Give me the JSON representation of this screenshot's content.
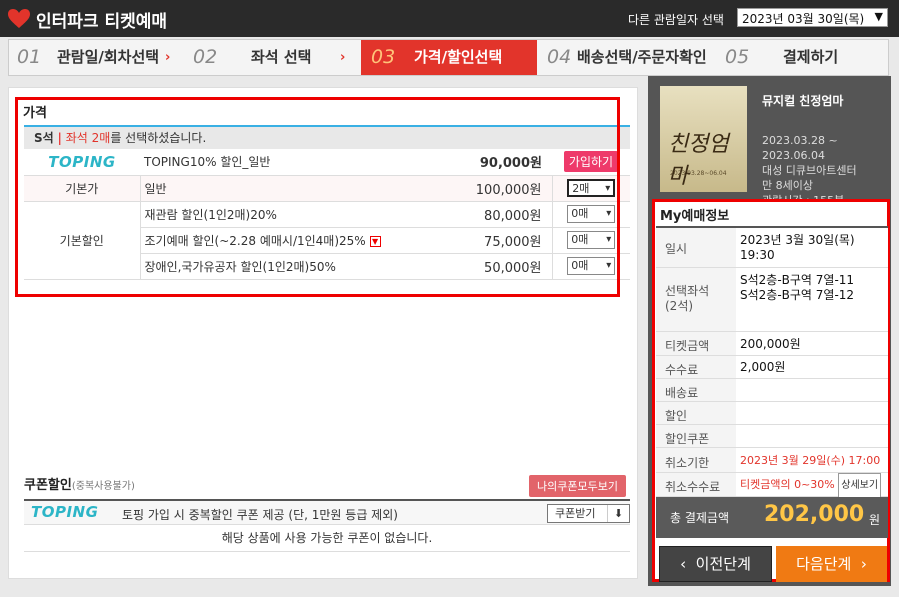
{
  "header": {
    "brand": "인터파크 티켓예매",
    "other_date_label": "다른 관람일자 선택",
    "selected_date": "2023년 03월 30일(목)"
  },
  "steps": [
    {
      "num": "01",
      "label": "관람일/회차선택"
    },
    {
      "num": "02",
      "label": "좌석 선택"
    },
    {
      "num": "03",
      "label": "가격/할인선택"
    },
    {
      "num": "04",
      "label": "배송선택/주문자확인"
    },
    {
      "num": "05",
      "label": "결제하기"
    }
  ],
  "price": {
    "title": "가격",
    "seat_grade": "S석",
    "seat_msg_hl": "좌석 2매",
    "seat_msg_rest": "를 선택하셨습니다.",
    "toping_logo": "TOPING",
    "toping_name": "TOPING10% 할인_일반",
    "toping_price": "90,000원",
    "join_label": "가입하기",
    "basic_label": "기본가",
    "basic_name": "일반",
    "basic_price": "100,000원",
    "basic_qty": "2매",
    "discount_label": "기본할인",
    "discounts": [
      {
        "name": "재관람 할인(1인2매)20%",
        "price": "80,000원",
        "qty": "0매"
      },
      {
        "name": "조기예매 할인(~2.28 예매시/1인4매)25%",
        "price": "75,000원",
        "qty": "0매"
      },
      {
        "name": "장애인,국가유공자 할인(1인2매)50%",
        "price": "50,000원",
        "qty": "0매"
      }
    ]
  },
  "coupon": {
    "title": "쿠폰할인",
    "note": "(중복사용불가)",
    "my_coupon_button": "나의쿠폰모두보기",
    "toping_logo": "TOPING",
    "row_text": "토핑 가입 시 중복할인 쿠폰 제공 (단, 1만원 등급 제외)",
    "receive_button": "쿠폰받기",
    "empty_text": "해당 상품에 사용 가능한 쿠폰이 없습니다."
  },
  "show": {
    "poster_title": "친정엄마",
    "poster_sub": "2023.03.28~06.04",
    "title": "뮤지컬 친정엄마",
    "period_start": "2023.03.28 ~",
    "period_end": "2023.06.04",
    "venue": "대성 디큐브아트센터",
    "age": "만 8세이상",
    "runtime": "관람시간 : 155분"
  },
  "my_reservation": {
    "title": "My예매정보",
    "date_label": "일시",
    "date_value": "2023년 3월 30일(목)",
    "time_value": "19:30",
    "seat_label": "선택좌석",
    "seat_count": "(2석)",
    "seat_1": "S석2층-B구역 7열-11",
    "seat_2": "S석2층-B구역 7열-12",
    "ticket_label": "티켓금액",
    "ticket_value": "200,000원",
    "fee_label": "수수료",
    "fee_value": "2,000원",
    "delivery_label": "배송료",
    "discount_label": "할인",
    "coupon_label": "할인쿠폰",
    "cancel_deadline_label": "취소기한",
    "cancel_deadline_value": "2023년 3월 29일(수) 17:00",
    "cancel_fee_label": "취소수수료",
    "cancel_fee_value": "티켓금액의 0~30%",
    "detail_button": "상세보기",
    "total_label": "총 결제금액",
    "total_value": "202,000",
    "total_unit": "원"
  },
  "nav": {
    "prev": "이전단계",
    "next": "다음단계"
  },
  "colors": {
    "accent_red": "#e2342b",
    "next_orange": "#f07a13",
    "total_yellow": "#ffc646",
    "toping_teal": "#2cb5c7"
  }
}
